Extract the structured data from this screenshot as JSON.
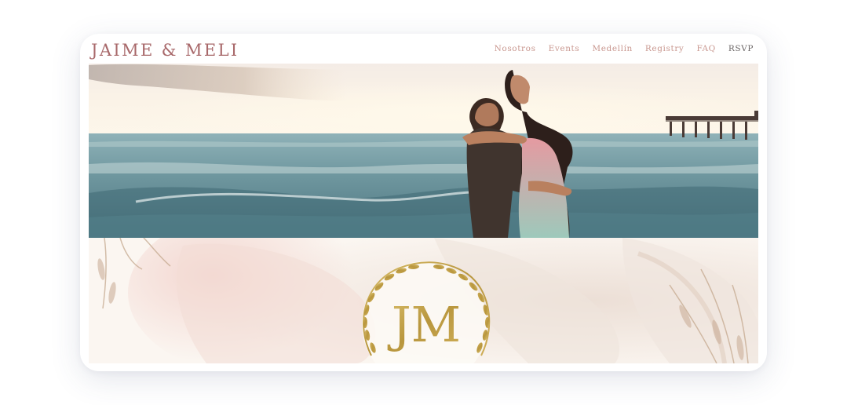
{
  "site": {
    "logo_text": "JAIME & MELI"
  },
  "nav": {
    "items": [
      {
        "label": "Nosotros"
      },
      {
        "label": "Events"
      },
      {
        "label": "Medellín"
      },
      {
        "label": "Registry"
      },
      {
        "label": "FAQ"
      },
      {
        "label": "RSVP"
      }
    ]
  },
  "monogram": {
    "letters": "JM"
  },
  "colors": {
    "logo": "#a8686a",
    "nav_link": "#c99890",
    "nav_active": "#6d6868",
    "gold": "#c2a24e"
  }
}
